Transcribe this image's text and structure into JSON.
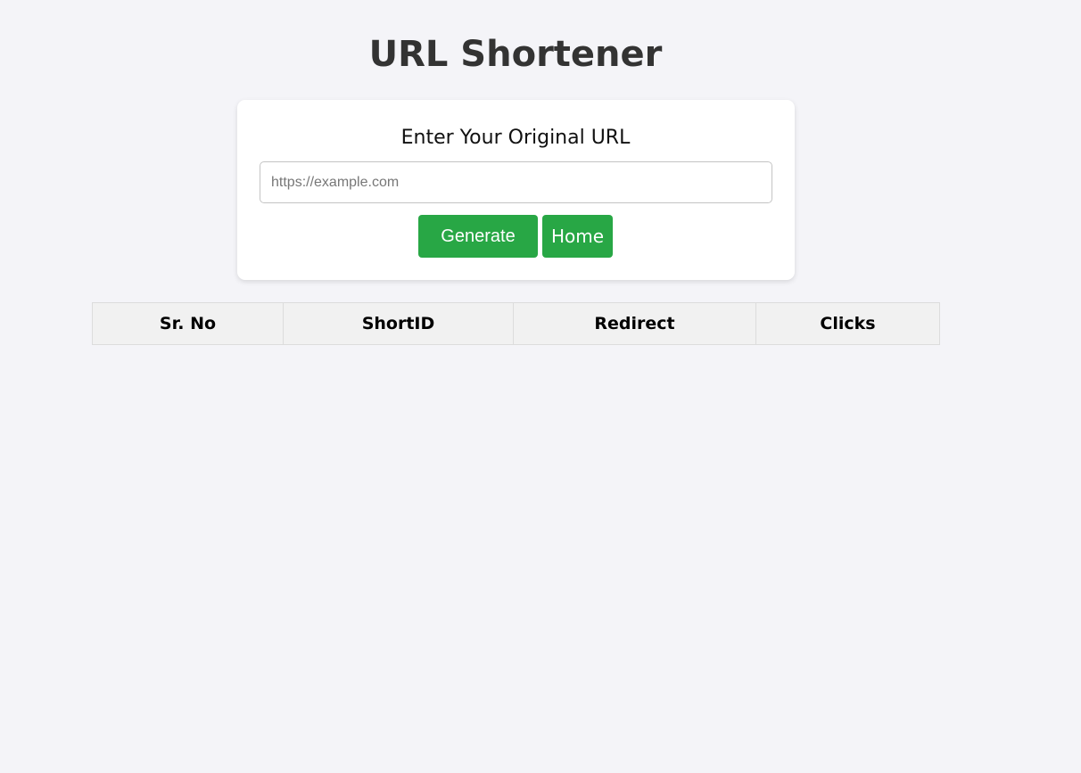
{
  "header": {
    "title": "URL Shortener"
  },
  "form": {
    "label": "Enter Your Original URL",
    "url_value": "",
    "url_placeholder": "https://example.com",
    "generate_label": "Generate",
    "home_label": "Home"
  },
  "table": {
    "columns": [
      "Sr. No",
      "ShortID",
      "Redirect",
      "Clicks"
    ],
    "rows": []
  },
  "colors": {
    "button_bg": "#28a745",
    "page_bg": "#f4f4f8",
    "title_text": "#333333"
  }
}
